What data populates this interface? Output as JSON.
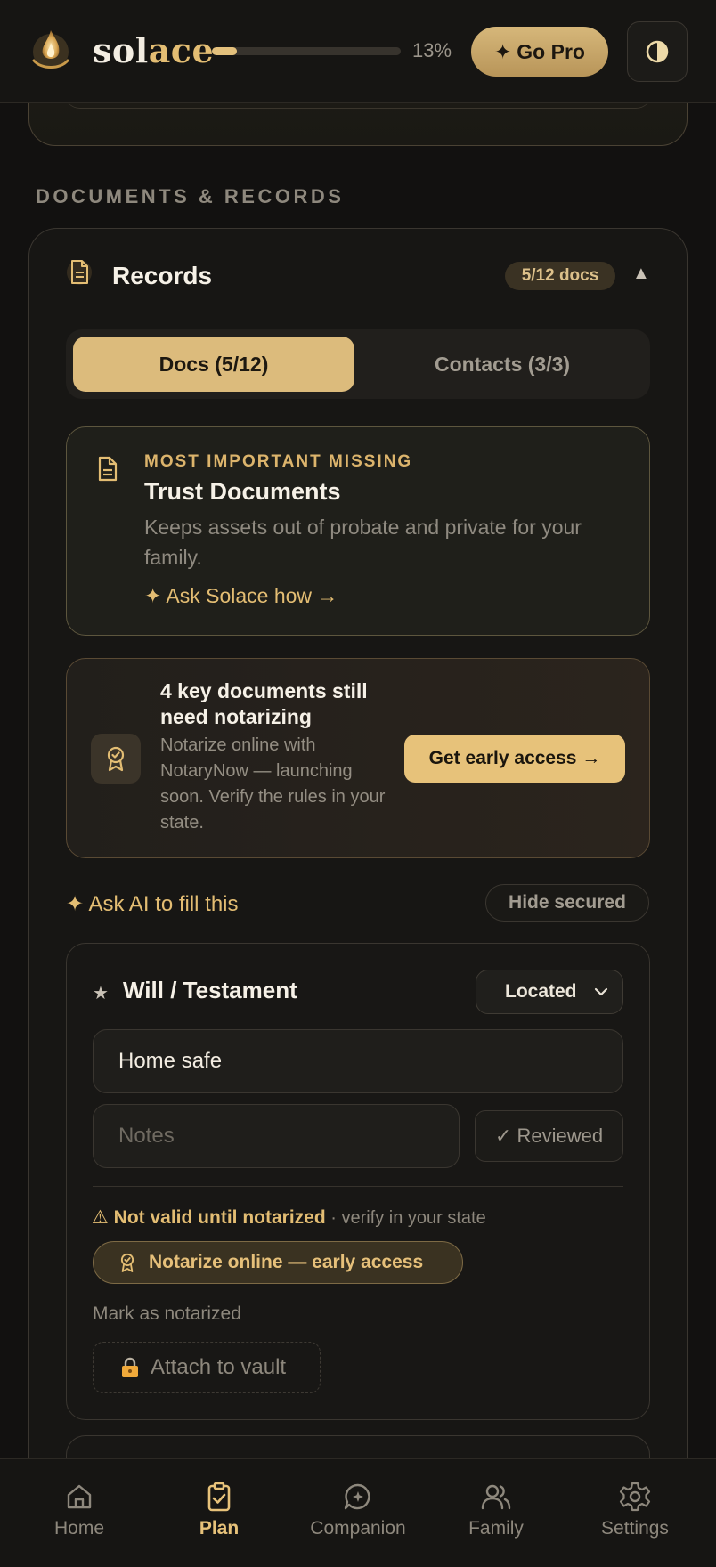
{
  "app": {
    "brand_prefix": "sol",
    "brand_suffix": "ace",
    "progress_percent_label": "13%",
    "progress_fraction": 0.13,
    "go_pro_label": "Go Pro",
    "go_pro_icon": "sparkle-icon",
    "theme_icon": "contrast-icon",
    "accent_color": "#e3bd73"
  },
  "section": {
    "title": "DOCUMENTS & RECORDS"
  },
  "records": {
    "title": "Records",
    "badge": "5/12 docs",
    "collapse_icon": "▲",
    "tabs": [
      {
        "label": "Docs (5/12)",
        "active": true
      },
      {
        "label": "Contacts (3/3)",
        "active": false
      }
    ]
  },
  "missing": {
    "kicker": "MOST IMPORTANT MISSING",
    "title": "Trust Documents",
    "description": "Keeps assets out of probate and private for your family.",
    "link": "✦ Ask Solace how →"
  },
  "notary_promo": {
    "title": "4 key documents still need notarizing",
    "description": "Notarize online with NotaryNow — launching soon. Verify the rules in your state.",
    "button": "Get early access →"
  },
  "toolbar": {
    "ask_ai": "✦ Ask AI to fill this",
    "hide_secured": "Hide secured"
  },
  "will_item": {
    "star": "★",
    "title": "Will / Testament",
    "status_value": "Located",
    "location_value": "Home safe",
    "notes_placeholder": "Notes",
    "reviewed_label": "✓ Reviewed",
    "warning_strong": "⚠ Not valid until notarized",
    "warning_sub": " · verify in your state",
    "notarize_button": "Notarize online — early access",
    "mark_notarized": "Mark as notarized",
    "attach_vault": "Attach to vault"
  },
  "nav": {
    "items": [
      {
        "label": "Home",
        "icon": "home-icon",
        "active": false
      },
      {
        "label": "Plan",
        "icon": "clipboard-check-icon",
        "active": true
      },
      {
        "label": "Companion",
        "icon": "chat-sparkle-icon",
        "active": false
      },
      {
        "label": "Family",
        "icon": "users-icon",
        "active": false
      },
      {
        "label": "Settings",
        "icon": "gear-icon",
        "active": false
      }
    ]
  }
}
